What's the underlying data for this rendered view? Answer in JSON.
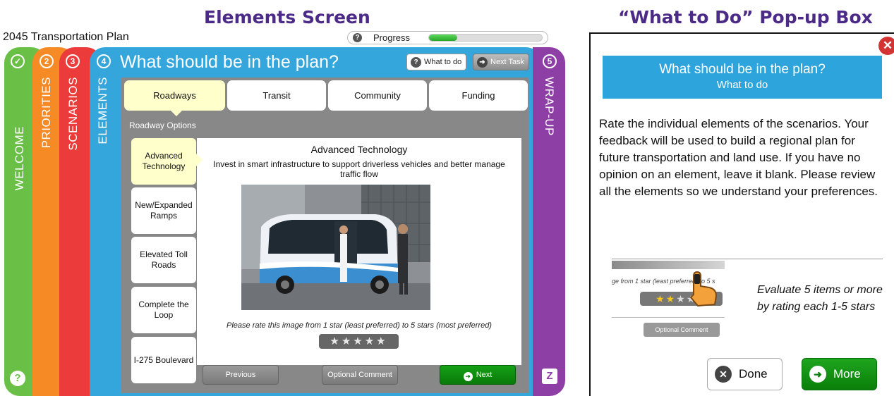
{
  "headings": {
    "elements_screen": "Elements Screen",
    "popup_box": "“What to Do” Pop-up Box"
  },
  "app": {
    "plan_title": "2045 Transportation Plan",
    "progress_label": "Progress",
    "progress_fraction": 0.25
  },
  "steps": [
    {
      "badge": "✓",
      "label": "WELCOME",
      "color": "#6ac046"
    },
    {
      "badge": "2",
      "label": "PRIORITIES",
      "color": "#f68a25"
    },
    {
      "badge": "3",
      "label": "SCENARIOS",
      "color": "#ec3b3b"
    },
    {
      "badge": "4",
      "label": "ELEMENTS",
      "color": "#34a6dc"
    },
    {
      "badge": "5",
      "label": "WRAP-UP",
      "color": "#8e3fa6"
    }
  ],
  "main": {
    "title": "What should be in the plan?",
    "what_to_do_label": "What to do",
    "next_task_label": "Next Task",
    "categories": [
      "Roadways",
      "Transit",
      "Community",
      "Funding"
    ],
    "options_label": "Roadway Options",
    "options": [
      "Advanced Technology",
      "New/Expanded Ramps",
      "Elevated Toll Roads",
      "Complete the Loop",
      "I-275 Boulevard"
    ],
    "content_title": "Advanced Technology",
    "content_desc": "Invest in smart infrastructure to support driverless vehicles and better manage traffic flow",
    "rate_text": "Please rate this image from 1 star (least preferred) to 5 stars (most preferred)",
    "rating": 0,
    "previous_label": "Previous",
    "comment_label": "Optional Comment",
    "next_label": "Next"
  },
  "popup": {
    "title": "What should be in the plan?",
    "subtitle": "What to do",
    "body": "Rate the individual elements of the scenarios. Your feedback will be used to build a regional plan for future transportation and land use. If you have no opinion on an element, leave it blank. Please review all the elements so we understand your preferences.",
    "mini_text": "ge from 1 star (least preferred) to 5 s",
    "mini_rating": 2,
    "mini_comment": "Optional Comment",
    "eval_text": "Evaluate 5 items or more by rating each 1-5 stars",
    "done_label": "Done",
    "more_label": "More"
  }
}
